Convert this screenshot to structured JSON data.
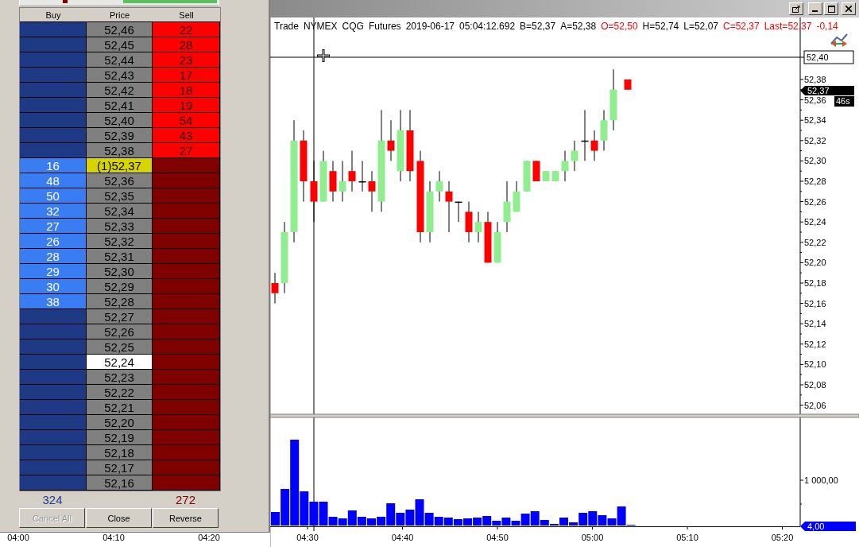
{
  "order_book": {
    "columns": [
      "Buy",
      "Price",
      "Sell"
    ],
    "rows": [
      {
        "price": "52,46",
        "sell": "22",
        "kind": "ask",
        "highlighted": false
      },
      {
        "price": "52,45",
        "sell": "28",
        "kind": "ask",
        "highlighted": false
      },
      {
        "price": "52,44",
        "sell": "23",
        "kind": "ask",
        "highlighted": false
      },
      {
        "price": "52,43",
        "sell": "17",
        "kind": "ask",
        "highlighted": false
      },
      {
        "price": "52,42",
        "sell": "18",
        "kind": "ask",
        "highlighted": false
      },
      {
        "price": "52,41",
        "sell": "19",
        "kind": "ask",
        "highlighted": false
      },
      {
        "price": "52,40",
        "sell": "54",
        "kind": "ask",
        "highlighted": false
      },
      {
        "price": "52,39",
        "sell": "43",
        "kind": "ask",
        "highlighted": false
      },
      {
        "price": "52,38",
        "sell": "27",
        "kind": "ask",
        "highlighted": false
      },
      {
        "buy": "16",
        "price": "(1)52,37",
        "kind": "last",
        "highlighted": false
      },
      {
        "buy": "48",
        "price": "52,36",
        "kind": "bid",
        "highlighted": false
      },
      {
        "buy": "50",
        "price": "52,35",
        "kind": "bid",
        "highlighted": false
      },
      {
        "buy": "32",
        "price": "52,34",
        "kind": "bid",
        "highlighted": false
      },
      {
        "buy": "27",
        "price": "52,33",
        "kind": "bid",
        "highlighted": false
      },
      {
        "buy": "26",
        "price": "52,32",
        "kind": "bid",
        "highlighted": false
      },
      {
        "buy": "28",
        "price": "52,31",
        "kind": "bid",
        "highlighted": false
      },
      {
        "buy": "29",
        "price": "52,30",
        "kind": "bid",
        "highlighted": false
      },
      {
        "buy": "30",
        "price": "52,29",
        "kind": "bid",
        "highlighted": false
      },
      {
        "buy": "38",
        "price": "52,28",
        "kind": "bid",
        "highlighted": false
      },
      {
        "price": "52,27",
        "kind": "none",
        "highlighted": false
      },
      {
        "price": "52,26",
        "kind": "none",
        "highlighted": false
      },
      {
        "price": "52,25",
        "kind": "none",
        "highlighted": false
      },
      {
        "price": "52,24",
        "kind": "none",
        "highlighted": true
      },
      {
        "price": "52,23",
        "kind": "none",
        "highlighted": false
      },
      {
        "price": "52,22",
        "kind": "none",
        "highlighted": false
      },
      {
        "price": "52,21",
        "kind": "none",
        "highlighted": false
      },
      {
        "price": "52,20",
        "kind": "none",
        "highlighted": false
      },
      {
        "price": "52,19",
        "kind": "none",
        "highlighted": false
      },
      {
        "price": "52,18",
        "kind": "none",
        "highlighted": false
      },
      {
        "price": "52,17",
        "kind": "none",
        "highlighted": false
      },
      {
        "price": "52,16",
        "kind": "none",
        "highlighted": false
      }
    ],
    "totals": {
      "buy": "324",
      "sell": "272"
    },
    "buttons": [
      {
        "label": "Cancel All",
        "disabled": true
      },
      {
        "label": "Close",
        "disabled": false
      },
      {
        "label": "Reverse",
        "disabled": false
      }
    ]
  },
  "chart": {
    "info": [
      {
        "text": "Trade",
        "color": "#000000"
      },
      {
        "text": "NYMEX",
        "color": "#000000"
      },
      {
        "text": "CQG",
        "color": "#000000"
      },
      {
        "text": "Futures",
        "color": "#000000"
      },
      {
        "text": "2019-06-17",
        "color": "#000000"
      },
      {
        "text": "05:04:12.692",
        "color": "#000000"
      },
      {
        "text": "B=52,37",
        "color": "#000000"
      },
      {
        "text": "A=52,38",
        "color": "#000000"
      },
      {
        "text": "O=52,50",
        "color": "#ff0000"
      },
      {
        "text": "H=52,74",
        "color": "#000000"
      },
      {
        "text": "L=52,07",
        "color": "#000000"
      },
      {
        "text": "C=52,37",
        "color": "#ff0000"
      },
      {
        "text": "Last=52,37",
        "color": "#ff0000"
      },
      {
        "text": "-0,14",
        "color": "#ff0000"
      }
    ],
    "price_axis": [
      "52,38",
      "52,36",
      "52,34",
      "52,32",
      "52,30",
      "52,28",
      "52,26",
      "52,24",
      "52,22",
      "52,20",
      "52,18",
      "52,16",
      "52,14",
      "52,12",
      "52,10",
      "52,08",
      "52,06"
    ],
    "crosshair_price": "52,40",
    "last_price": "52,37",
    "countdown": "46s",
    "volume_axis": "1 000,00",
    "last_volume": "4,00",
    "time_axis": [
      "04:00",
      "04:10",
      "04:20",
      "04:30",
      "04:40",
      "04:50",
      "05:00",
      "05:10",
      "05:20"
    ]
  }
}
